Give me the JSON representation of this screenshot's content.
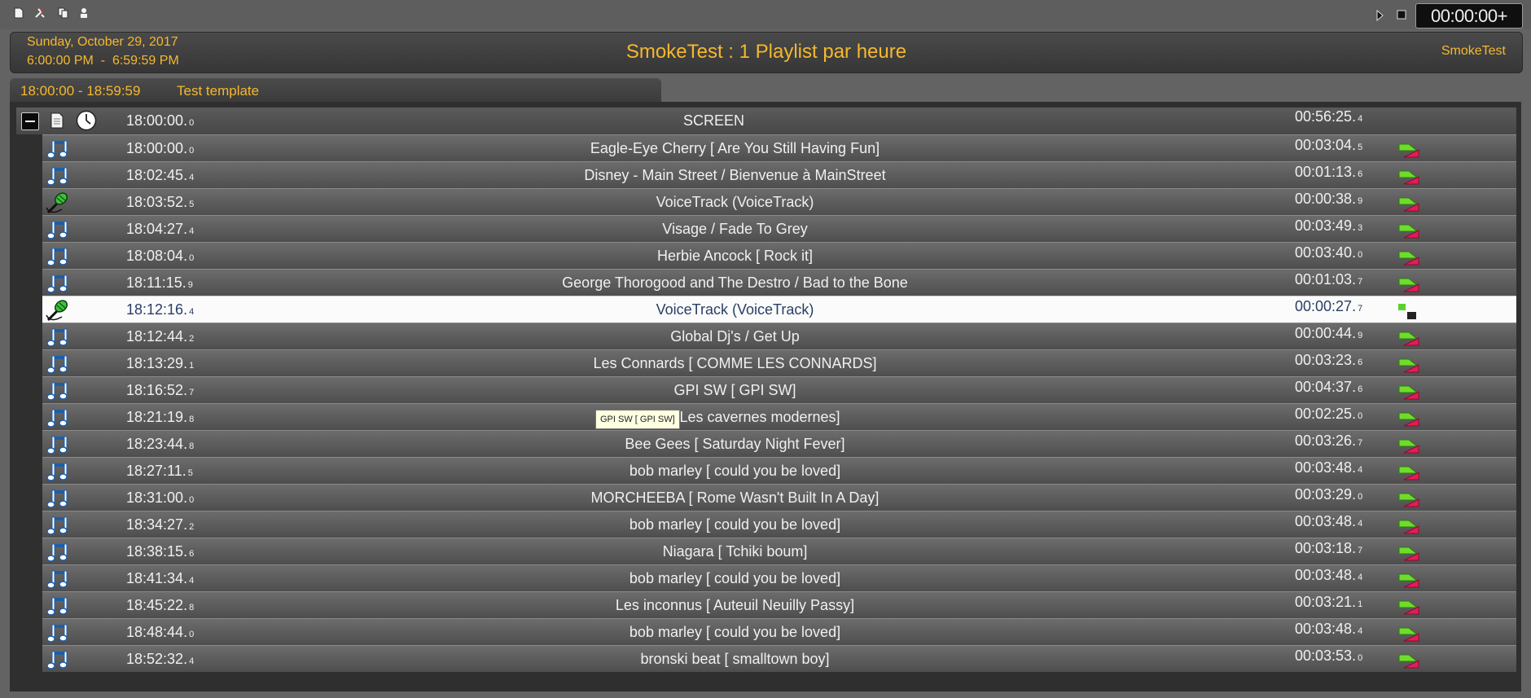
{
  "toolbar": {
    "icons": [
      "new-document-icon",
      "tools-icon",
      "copy-icon",
      "user-icon"
    ],
    "play_icon": "play-icon",
    "stop_icon": "stop-icon",
    "clock": "00:00:00+"
  },
  "header": {
    "date": "Sunday, October 29, 2017",
    "time_range": "6:00:00 PM  -  6:59:59 PM",
    "title": "SmokeTest : 1 Playlist par heure",
    "station": "SmokeTest",
    "accent_color": "#f5b82e"
  },
  "tab": {
    "time_range": "18:00:00 - 18:59:59",
    "name": "Test template"
  },
  "screen_row": {
    "time": "18:00:00.",
    "time_sub": "0",
    "title": "SCREEN",
    "duration": "00:56:25.",
    "duration_sub": "4"
  },
  "tracks": [
    {
      "type": "music",
      "time": "18:00:00.",
      "time_sub": "0",
      "title": "Eagle-Eye Cherry [ Are You Still Having Fun]",
      "duration": "00:03:04.",
      "duration_sub": "5",
      "status": "queued"
    },
    {
      "type": "music",
      "time": "18:02:45.",
      "time_sub": "4",
      "title": "Disney - Main Street / Bienvenue à MainStreet",
      "duration": "00:01:13.",
      "duration_sub": "6",
      "status": "queued"
    },
    {
      "type": "voice",
      "time": "18:03:52.",
      "time_sub": "5",
      "title": "VoiceTrack (VoiceTrack)",
      "duration": "00:00:38.",
      "duration_sub": "9",
      "status": "queued"
    },
    {
      "type": "music",
      "time": "18:04:27.",
      "time_sub": "4",
      "title": "Visage / Fade To Grey",
      "duration": "00:03:49.",
      "duration_sub": "3",
      "status": "queued"
    },
    {
      "type": "music",
      "time": "18:08:04.",
      "time_sub": "0",
      "title": "Herbie Ancock [ Rock it]",
      "duration": "00:03:40.",
      "duration_sub": "0",
      "status": "queued"
    },
    {
      "type": "music",
      "time": "18:11:15.",
      "time_sub": "9",
      "title": "George Thorogood and The Destro / Bad to the Bone",
      "duration": "00:01:03.",
      "duration_sub": "7",
      "status": "queued"
    },
    {
      "type": "voice",
      "time": "18:12:16.",
      "time_sub": "4",
      "title": "VoiceTrack (VoiceTrack)",
      "duration": "00:00:27.",
      "duration_sub": "7",
      "status": "playing"
    },
    {
      "type": "music",
      "time": "18:12:44.",
      "time_sub": "2",
      "title": "Global Dj's / Get Up",
      "duration": "00:00:44.",
      "duration_sub": "9",
      "status": "queued"
    },
    {
      "type": "music",
      "time": "18:13:29.",
      "time_sub": "1",
      "title": "Les Connards [ COMME LES CONNARDS]",
      "duration": "00:03:23.",
      "duration_sub": "6",
      "status": "queued"
    },
    {
      "type": "music",
      "time": "18:16:52.",
      "time_sub": "7",
      "title": "GPI SW [ GPI SW]",
      "duration": "00:04:37.",
      "duration_sub": "6",
      "status": "queued"
    },
    {
      "type": "music",
      "time": "18:21:19.",
      "time_sub": "8",
      "title": "O.T.H [ Les cavernes modernes]",
      "duration": "00:02:25.",
      "duration_sub": "0",
      "status": "queued"
    },
    {
      "type": "music",
      "time": "18:23:44.",
      "time_sub": "8",
      "title": "Bee Gees [ Saturday Night Fever]",
      "duration": "00:03:26.",
      "duration_sub": "7",
      "status": "queued"
    },
    {
      "type": "music",
      "time": "18:27:11.",
      "time_sub": "5",
      "title": "bob marley [ could you be loved]",
      "duration": "00:03:48.",
      "duration_sub": "4",
      "status": "queued"
    },
    {
      "type": "music",
      "time": "18:31:00.",
      "time_sub": "0",
      "title": "MORCHEEBA [ Rome Wasn't Built In A Day]",
      "duration": "00:03:29.",
      "duration_sub": "0",
      "status": "queued"
    },
    {
      "type": "music",
      "time": "18:34:27.",
      "time_sub": "2",
      "title": "bob marley [ could you be loved]",
      "duration": "00:03:48.",
      "duration_sub": "4",
      "status": "queued"
    },
    {
      "type": "music",
      "time": "18:38:15.",
      "time_sub": "6",
      "title": "Niagara [ Tchiki boum]",
      "duration": "00:03:18.",
      "duration_sub": "7",
      "status": "queued"
    },
    {
      "type": "music",
      "time": "18:41:34.",
      "time_sub": "4",
      "title": "bob marley [ could you be loved]",
      "duration": "00:03:48.",
      "duration_sub": "4",
      "status": "queued"
    },
    {
      "type": "music",
      "time": "18:45:22.",
      "time_sub": "8",
      "title": "Les inconnus [ Auteuil Neuilly Passy]",
      "duration": "00:03:21.",
      "duration_sub": "1",
      "status": "queued"
    },
    {
      "type": "music",
      "time": "18:48:44.",
      "time_sub": "0",
      "title": "bob marley [ could you be loved]",
      "duration": "00:03:48.",
      "duration_sub": "4",
      "status": "queued"
    },
    {
      "type": "music",
      "time": "18:52:32.",
      "time_sub": "4",
      "title": "bronski beat [ smalltown boy]",
      "duration": "00:03:53.",
      "duration_sub": "0",
      "status": "queued"
    }
  ],
  "tooltip": "GPI SW [ GPI SW]"
}
